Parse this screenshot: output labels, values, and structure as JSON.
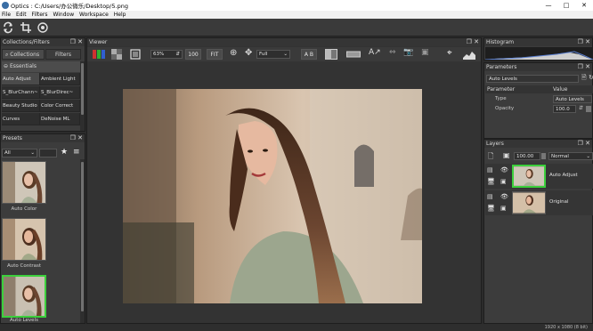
{
  "window": {
    "title": "Optics : C:/Users/办公微乐/Desktop/5.png",
    "minimize": "—",
    "maximize": "□",
    "close": "✕"
  },
  "menu": [
    "File",
    "Edit",
    "Filters",
    "Window",
    "Workspace",
    "Help"
  ],
  "toolbar": {
    "icons": [
      "sync-icon",
      "crop-icon",
      "target-icon"
    ]
  },
  "left": {
    "panel_title": "Collections/Filters",
    "tabs": {
      "collections": "Collections",
      "filters": "Filters"
    },
    "section": "Essentials",
    "items": [
      [
        "Auto Adjust",
        "Ambient Light"
      ],
      [
        "S_BlurChann~",
        "S_BlurDirec~"
      ],
      [
        "Beauty Studio",
        "Color Correct"
      ],
      [
        "Curves",
        "DeNoise ML"
      ]
    ],
    "selected_item": "Auto Adjust"
  },
  "presets": {
    "panel_title": "Presets",
    "filter_value": "All",
    "items": [
      "Auto Color",
      "Auto Contrast",
      "Auto Levels"
    ]
  },
  "viewer": {
    "panel_title": "Viewer",
    "zoom_pct": "63%",
    "btn_100": "100",
    "btn_fit": "FIT",
    "view_mode": "Full",
    "btn_ab": "A B"
  },
  "histogram": {
    "panel_title": "Histogram"
  },
  "parameters": {
    "panel_title": "Parameters",
    "preset_value": "Auto Levels",
    "col_param": "Parameter",
    "col_value": "Value",
    "rows": [
      {
        "label": "Type",
        "value": "Auto Levels"
      },
      {
        "label": "Opacity",
        "value": "100.0"
      }
    ]
  },
  "layers": {
    "panel_title": "Layers",
    "opacity": "100.00",
    "blend": "Normal",
    "items": [
      {
        "name": "Auto Adjust"
      },
      {
        "name": "Original"
      }
    ]
  },
  "status": {
    "text": "1920 x 1080 (8 bit)"
  },
  "colors": {
    "accent_green": "#3cd03c",
    "bg": "#2b2b2b",
    "panel": "#3c3c3c"
  }
}
